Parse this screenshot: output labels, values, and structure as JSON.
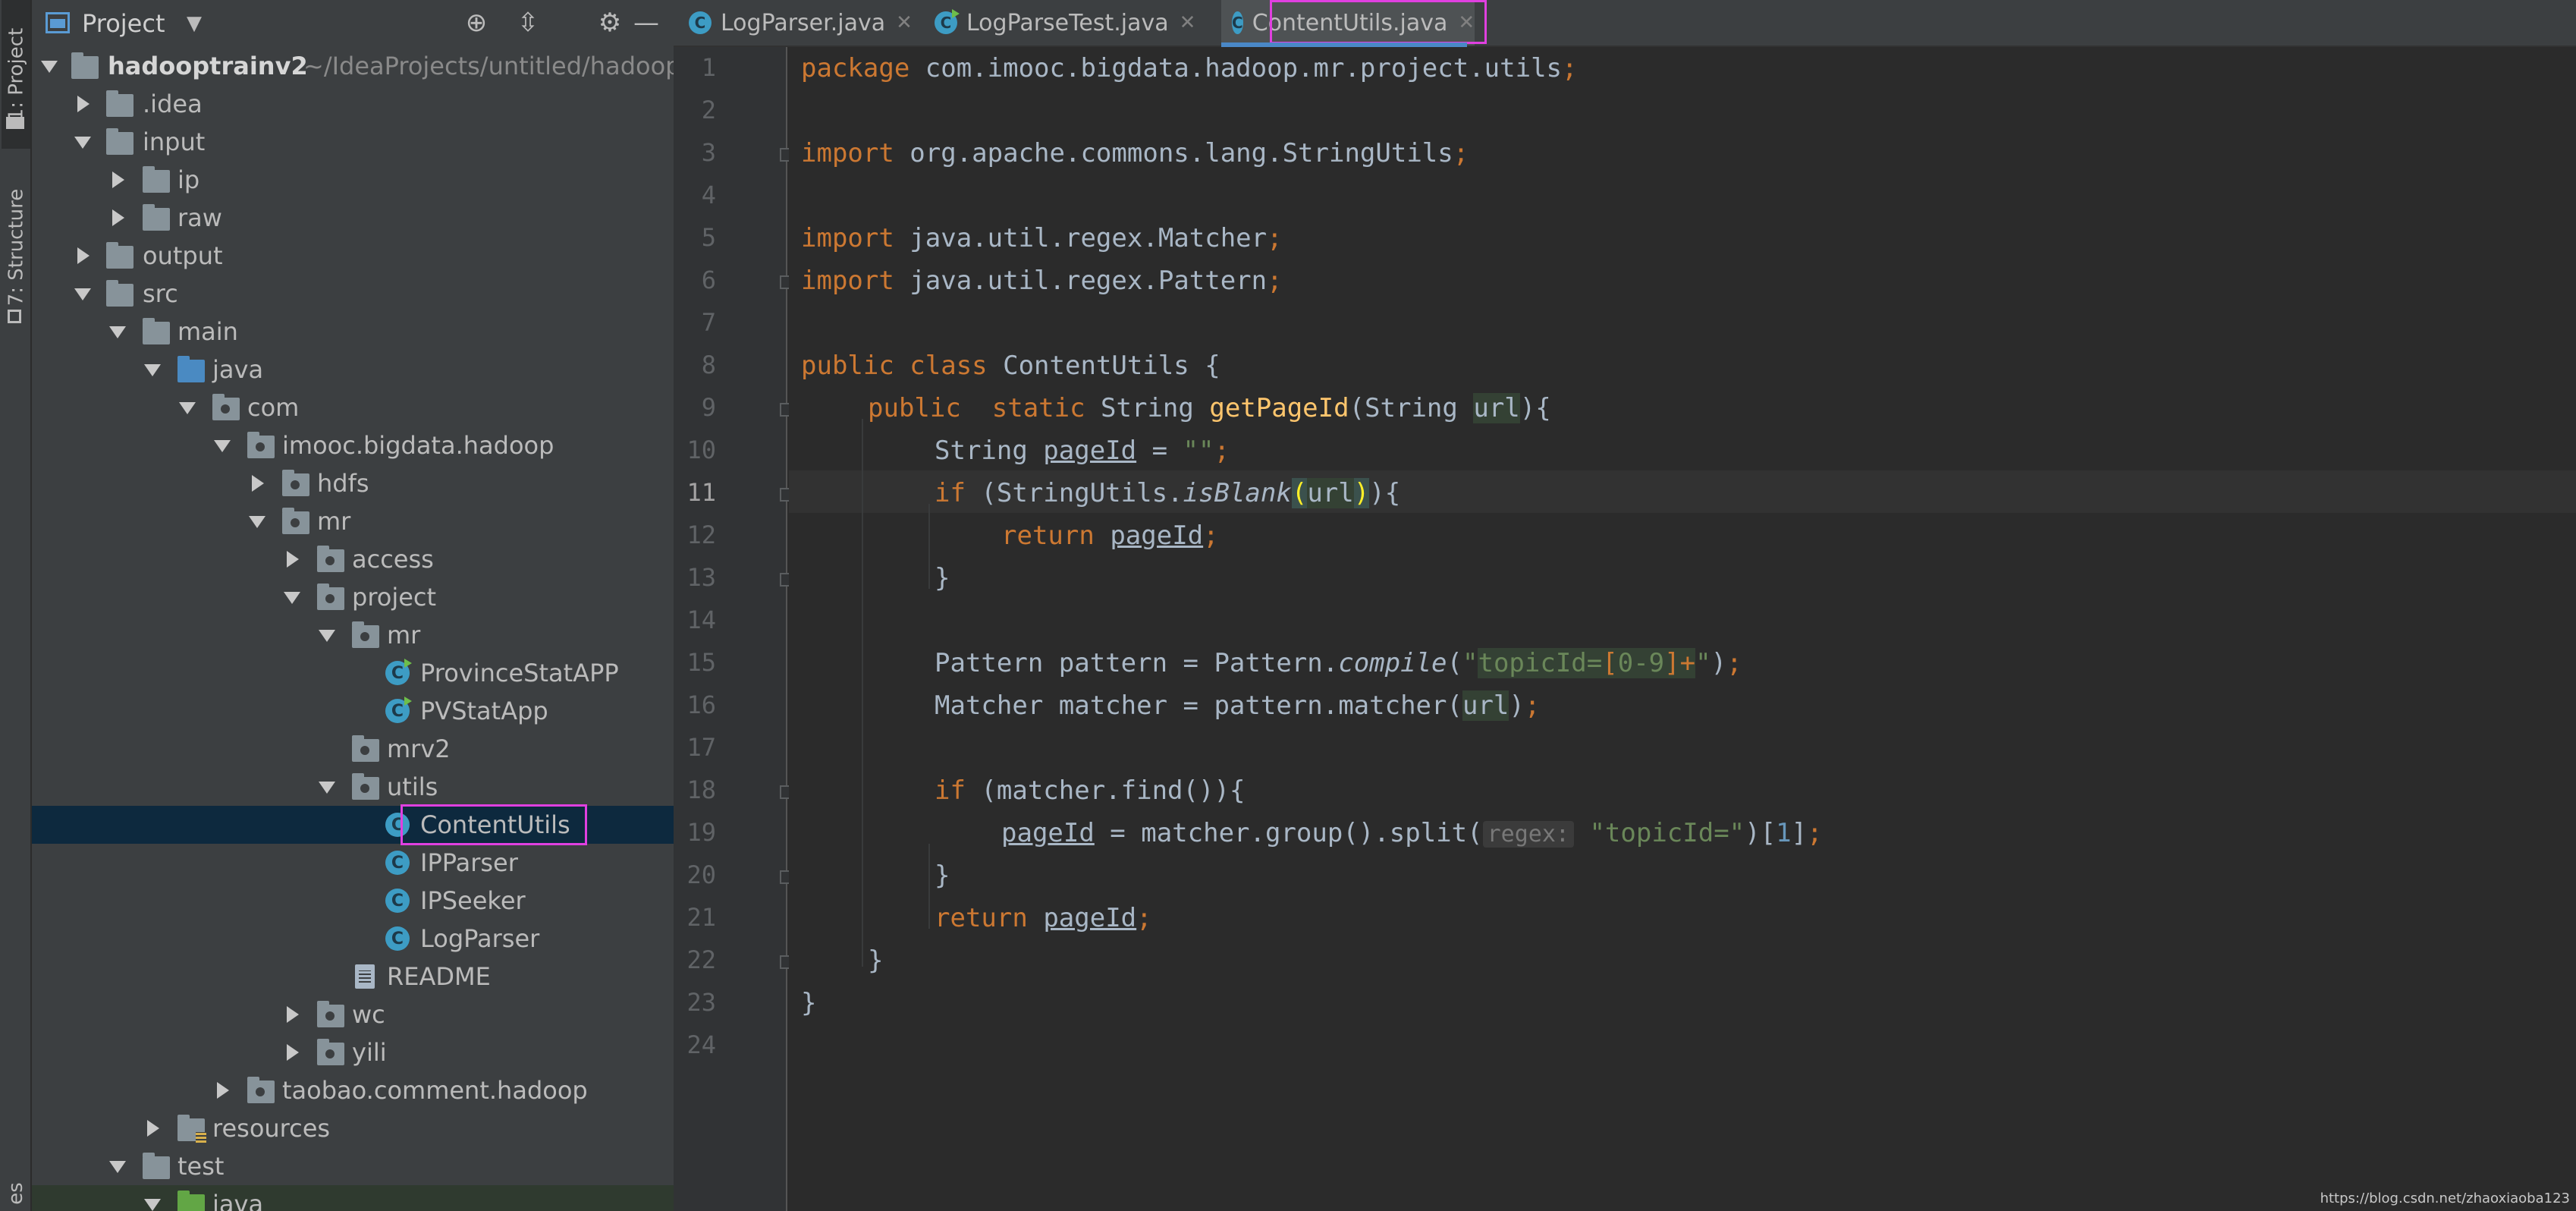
{
  "sidebar_tabs": [
    {
      "label": "1: Project"
    },
    {
      "label": "7: Structure"
    },
    {
      "label": "es"
    }
  ],
  "project_panel": {
    "title": "Project",
    "header_icons": [
      "target-icon",
      "collapse-all-icon",
      "gear-icon",
      "minimize-icon"
    ]
  },
  "tree": {
    "root_name": "hadooptrainv2",
    "root_path": "~/IdeaProjects/untitled/hadoop",
    "items": [
      {
        "label": ".idea"
      },
      {
        "label": "input"
      },
      {
        "label": "ip"
      },
      {
        "label": "raw"
      },
      {
        "label": "output"
      },
      {
        "label": "src"
      },
      {
        "label": "main"
      },
      {
        "label": "java"
      },
      {
        "label": "com"
      },
      {
        "label": "imooc.bigdata.hadoop"
      },
      {
        "label": "hdfs"
      },
      {
        "label": "mr"
      },
      {
        "label": "access"
      },
      {
        "label": "project"
      },
      {
        "label": "mr"
      },
      {
        "label": "ProvinceStatAPP"
      },
      {
        "label": "PVStatApp"
      },
      {
        "label": "mrv2"
      },
      {
        "label": "utils"
      },
      {
        "label": "ContentUtils"
      },
      {
        "label": "IPParser"
      },
      {
        "label": "IPSeeker"
      },
      {
        "label": "LogParser"
      },
      {
        "label": "README"
      },
      {
        "label": "wc"
      },
      {
        "label": "yili"
      },
      {
        "label": "taobao.comment.hadoop"
      },
      {
        "label": "resources"
      },
      {
        "label": "test"
      },
      {
        "label": "java"
      }
    ]
  },
  "tabs": [
    {
      "label": "LogParser.java"
    },
    {
      "label": "LogParseTest.java"
    },
    {
      "label": "ContentUtils.java"
    }
  ],
  "editor": {
    "current_line": "11",
    "line_numbers": [
      "1",
      "2",
      "3",
      "4",
      "5",
      "6",
      "7",
      "8",
      "9",
      "10",
      "11",
      "12",
      "13",
      "14",
      "15",
      "16",
      "17",
      "18",
      "19",
      "20",
      "21",
      "22",
      "23",
      "24"
    ],
    "tokens": {
      "l1_kw": "package",
      "l1_rest": " com.imooc.bigdata.hadoop.mr.project.utils",
      "l3_kw": "import",
      "l3_rest": " org.apache.commons.lang.StringUtils",
      "l5_kw": "import",
      "l5_rest": " java.util.regex.Matcher",
      "l6_kw": "import",
      "l6_rest": " java.util.regex.Pattern",
      "l8_kw": "public class",
      "l8_rest": " ContentUtils {",
      "l9_kw": "public  static",
      "l9_type": " String ",
      "l9_fn": "getPageId",
      "l9_open": "(String ",
      "l9_param": "url",
      "l9_close": "){",
      "l10_type": "String ",
      "l10_var": "pageId",
      "l10_eq": " = ",
      "l10_str": "\"\"",
      "l11_kw": "if",
      "l11_a": " (StringUtils.",
      "l11_fn": "isBlank",
      "l11_p1": "(",
      "l11_param": "url",
      "l11_p2": ")",
      "l11_b": "){",
      "l12_kw": "return",
      "l12_var": "pageId",
      "l13": "}",
      "l15_a": "Pattern pattern = Pattern.",
      "l15_fn": "compile",
      "l15_b": "(",
      "l15_q1": "\"",
      "l15_s1": "topicId=",
      "l15_s2": "[",
      "l15_s3": "0-9",
      "l15_s4": "]+",
      "l15_q2": "\"",
      "l15_c": ")",
      "l16_a": "Matcher matcher = pattern.matcher(",
      "l16_param": "url",
      "l16_b": ")",
      "l18_kw": "if",
      "l18_rest": " (matcher.find()){",
      "l19_var": "pageId",
      "l19_a": " = matcher.group().split(",
      "l19_hint": "regex:",
      "l19_str": "\"topicId=\"",
      "l19_b": ")[",
      "l19_num": "1",
      "l19_c": "]",
      "l20": "}",
      "l21_kw": "return",
      "l21_var": "pageId",
      "l22": "}",
      "l23": "}",
      "semi": ";"
    }
  },
  "watermark": "https://blog.csdn.net/zhaoxiaoba123",
  "colors": {
    "keyword": "#cc7832",
    "method": "#ffc66d",
    "string": "#6a8759",
    "number": "#6897bb",
    "text": "#a9b7c6",
    "selection": "#0d293e",
    "highlight_box": "#e040e0"
  }
}
